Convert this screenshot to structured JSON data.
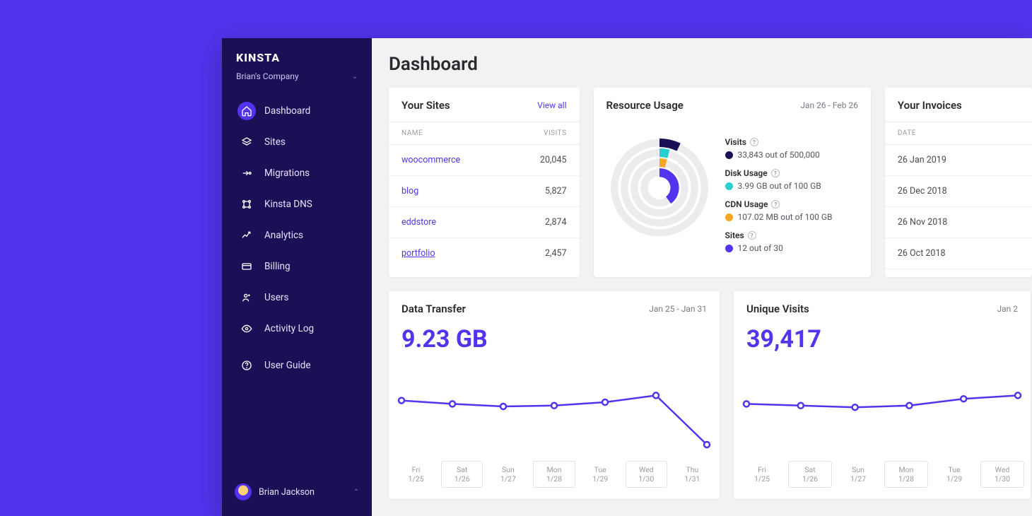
{
  "brand": {
    "logo": "KINSTA",
    "company": "Brian's Company"
  },
  "sidebar": {
    "items": [
      {
        "label": "Dashboard"
      },
      {
        "label": "Sites"
      },
      {
        "label": "Migrations"
      },
      {
        "label": "Kinsta DNS"
      },
      {
        "label": "Analytics"
      },
      {
        "label": "Billing"
      },
      {
        "label": "Users"
      },
      {
        "label": "Activity Log"
      },
      {
        "label": "User Guide"
      }
    ],
    "user": "Brian Jackson"
  },
  "page": {
    "title": "Dashboard"
  },
  "sites": {
    "title": "Your Sites",
    "view_all": "View all",
    "col_name": "NAME",
    "col_visits": "VISITS",
    "rows": [
      {
        "name": "woocommerce",
        "visits": "20,045"
      },
      {
        "name": "blog",
        "visits": "5,827"
      },
      {
        "name": "eddstore",
        "visits": "2,874"
      },
      {
        "name": "portfolio",
        "visits": "2,457"
      }
    ]
  },
  "resource": {
    "title": "Resource Usage",
    "range": "Jan 26 - Feb 26",
    "colors": {
      "visits": "#1C0F56",
      "disk": "#2ACFCF",
      "cdn": "#F5A623",
      "sites": "#5333ED"
    },
    "legend": {
      "visits_title": "Visits",
      "visits_line": "33,843 out of 500,000",
      "disk_title": "Disk Usage",
      "disk_line": "3.99 GB out of 100 GB",
      "cdn_title": "CDN Usage",
      "cdn_line": "107.02 MB out of 100 GB",
      "sites_title": "Sites",
      "sites_line": "12 out of 30"
    }
  },
  "invoices": {
    "title": "Your Invoices",
    "col_date": "DATE",
    "rows": [
      "26 Jan 2019",
      "26 Dec 2018",
      "26 Nov 2018",
      "26 Oct 2018"
    ]
  },
  "transfer": {
    "title": "Data Transfer",
    "range": "Jan 25 - Jan 31",
    "metric": "9.23 GB"
  },
  "visits": {
    "title": "Unique Visits",
    "range": "Jan 2",
    "metric": "39,417"
  },
  "chart_data": [
    {
      "type": "line",
      "title": "Data Transfer",
      "categories": [
        "Fri 1/25",
        "Sat 1/26",
        "Sun 1/27",
        "Mon 1/28",
        "Tue 1/29",
        "Wed 1/30",
        "Thu 1/31"
      ],
      "values": [
        62,
        58,
        55,
        56,
        60,
        68,
        10
      ],
      "ylim": [
        0,
        100
      ],
      "xlabel": "",
      "ylabel": ""
    },
    {
      "type": "line",
      "title": "Unique Visits",
      "categories": [
        "Fri 1/25",
        "Sat 1/26",
        "Sun 1/27",
        "Mon 1/28",
        "Tue 1/29",
        "Wed 1/30"
      ],
      "values": [
        58,
        56,
        54,
        56,
        64,
        68
      ],
      "ylim": [
        0,
        100
      ],
      "xlabel": "",
      "ylabel": ""
    }
  ]
}
